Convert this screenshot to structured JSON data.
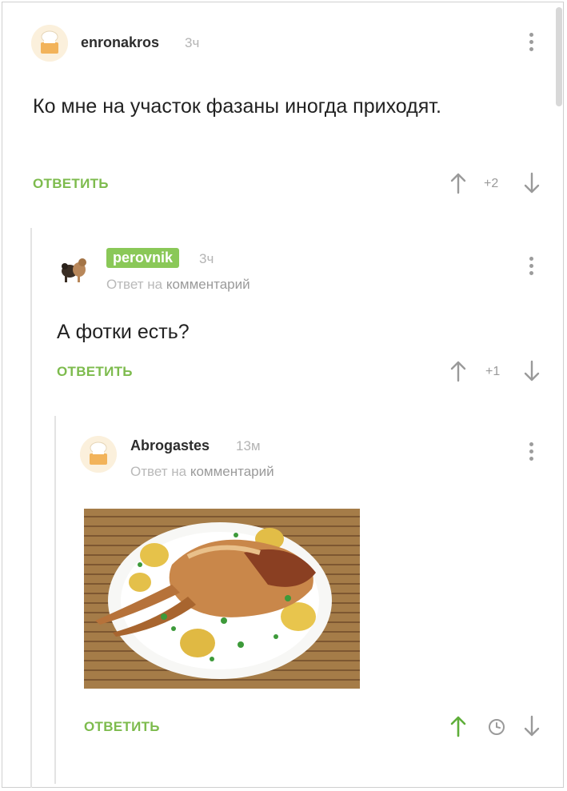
{
  "comments": [
    {
      "author": "enronakros",
      "time": "3ч",
      "text": "Ко мне на участок фазаны иногда приходят.",
      "reply_label": "ОТВЕТИТЬ",
      "score": "+2"
    },
    {
      "author": "perovnik",
      "time": "3ч",
      "reply_prefix": "Ответ на",
      "reply_target": "комментарий",
      "text": "А фотки есть?",
      "reply_label": "ОТВЕТИТЬ",
      "score": "+1"
    },
    {
      "author": "Abrogastes",
      "time": "13м",
      "reply_prefix": "Ответ на",
      "reply_target": "комментарий",
      "image_subject": "roasted pheasant with potatoes on a plate",
      "reply_label": "ОТВЕТИТЬ"
    }
  ],
  "colors": {
    "accent": "#7dbb4d",
    "badge": "#8ac858",
    "muted": "#b4b4b4"
  },
  "icons": [
    "upvote-arrow-icon",
    "downvote-arrow-icon",
    "clock-icon",
    "more-dots-icon"
  ]
}
